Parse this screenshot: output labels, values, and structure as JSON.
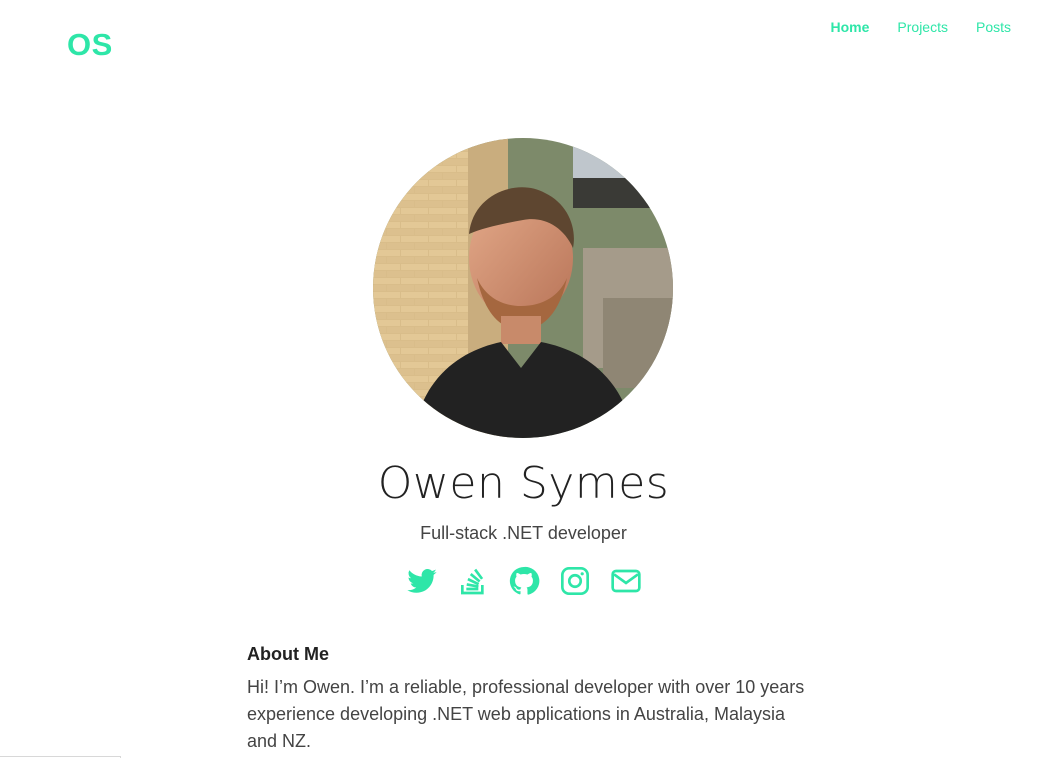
{
  "header": {
    "logo": "OS",
    "nav": [
      {
        "label": "Home",
        "active": true
      },
      {
        "label": "Projects",
        "active": false
      },
      {
        "label": "Posts",
        "active": false
      }
    ]
  },
  "profile": {
    "name": "Owen Symes",
    "tagline": "Full-stack .NET developer"
  },
  "socials": [
    {
      "icon": "twitter-icon"
    },
    {
      "icon": "stackoverflow-icon"
    },
    {
      "icon": "github-icon"
    },
    {
      "icon": "instagram-icon"
    },
    {
      "icon": "email-icon"
    }
  ],
  "about": {
    "heading": "About Me",
    "body": "Hi! I’m Owen. I’m a reliable, professional developer with over 10 years experience developing .NET web applications in Australia, Malaysia and NZ."
  },
  "colors": {
    "accent": "#2ee6a8",
    "text": "#222222"
  }
}
